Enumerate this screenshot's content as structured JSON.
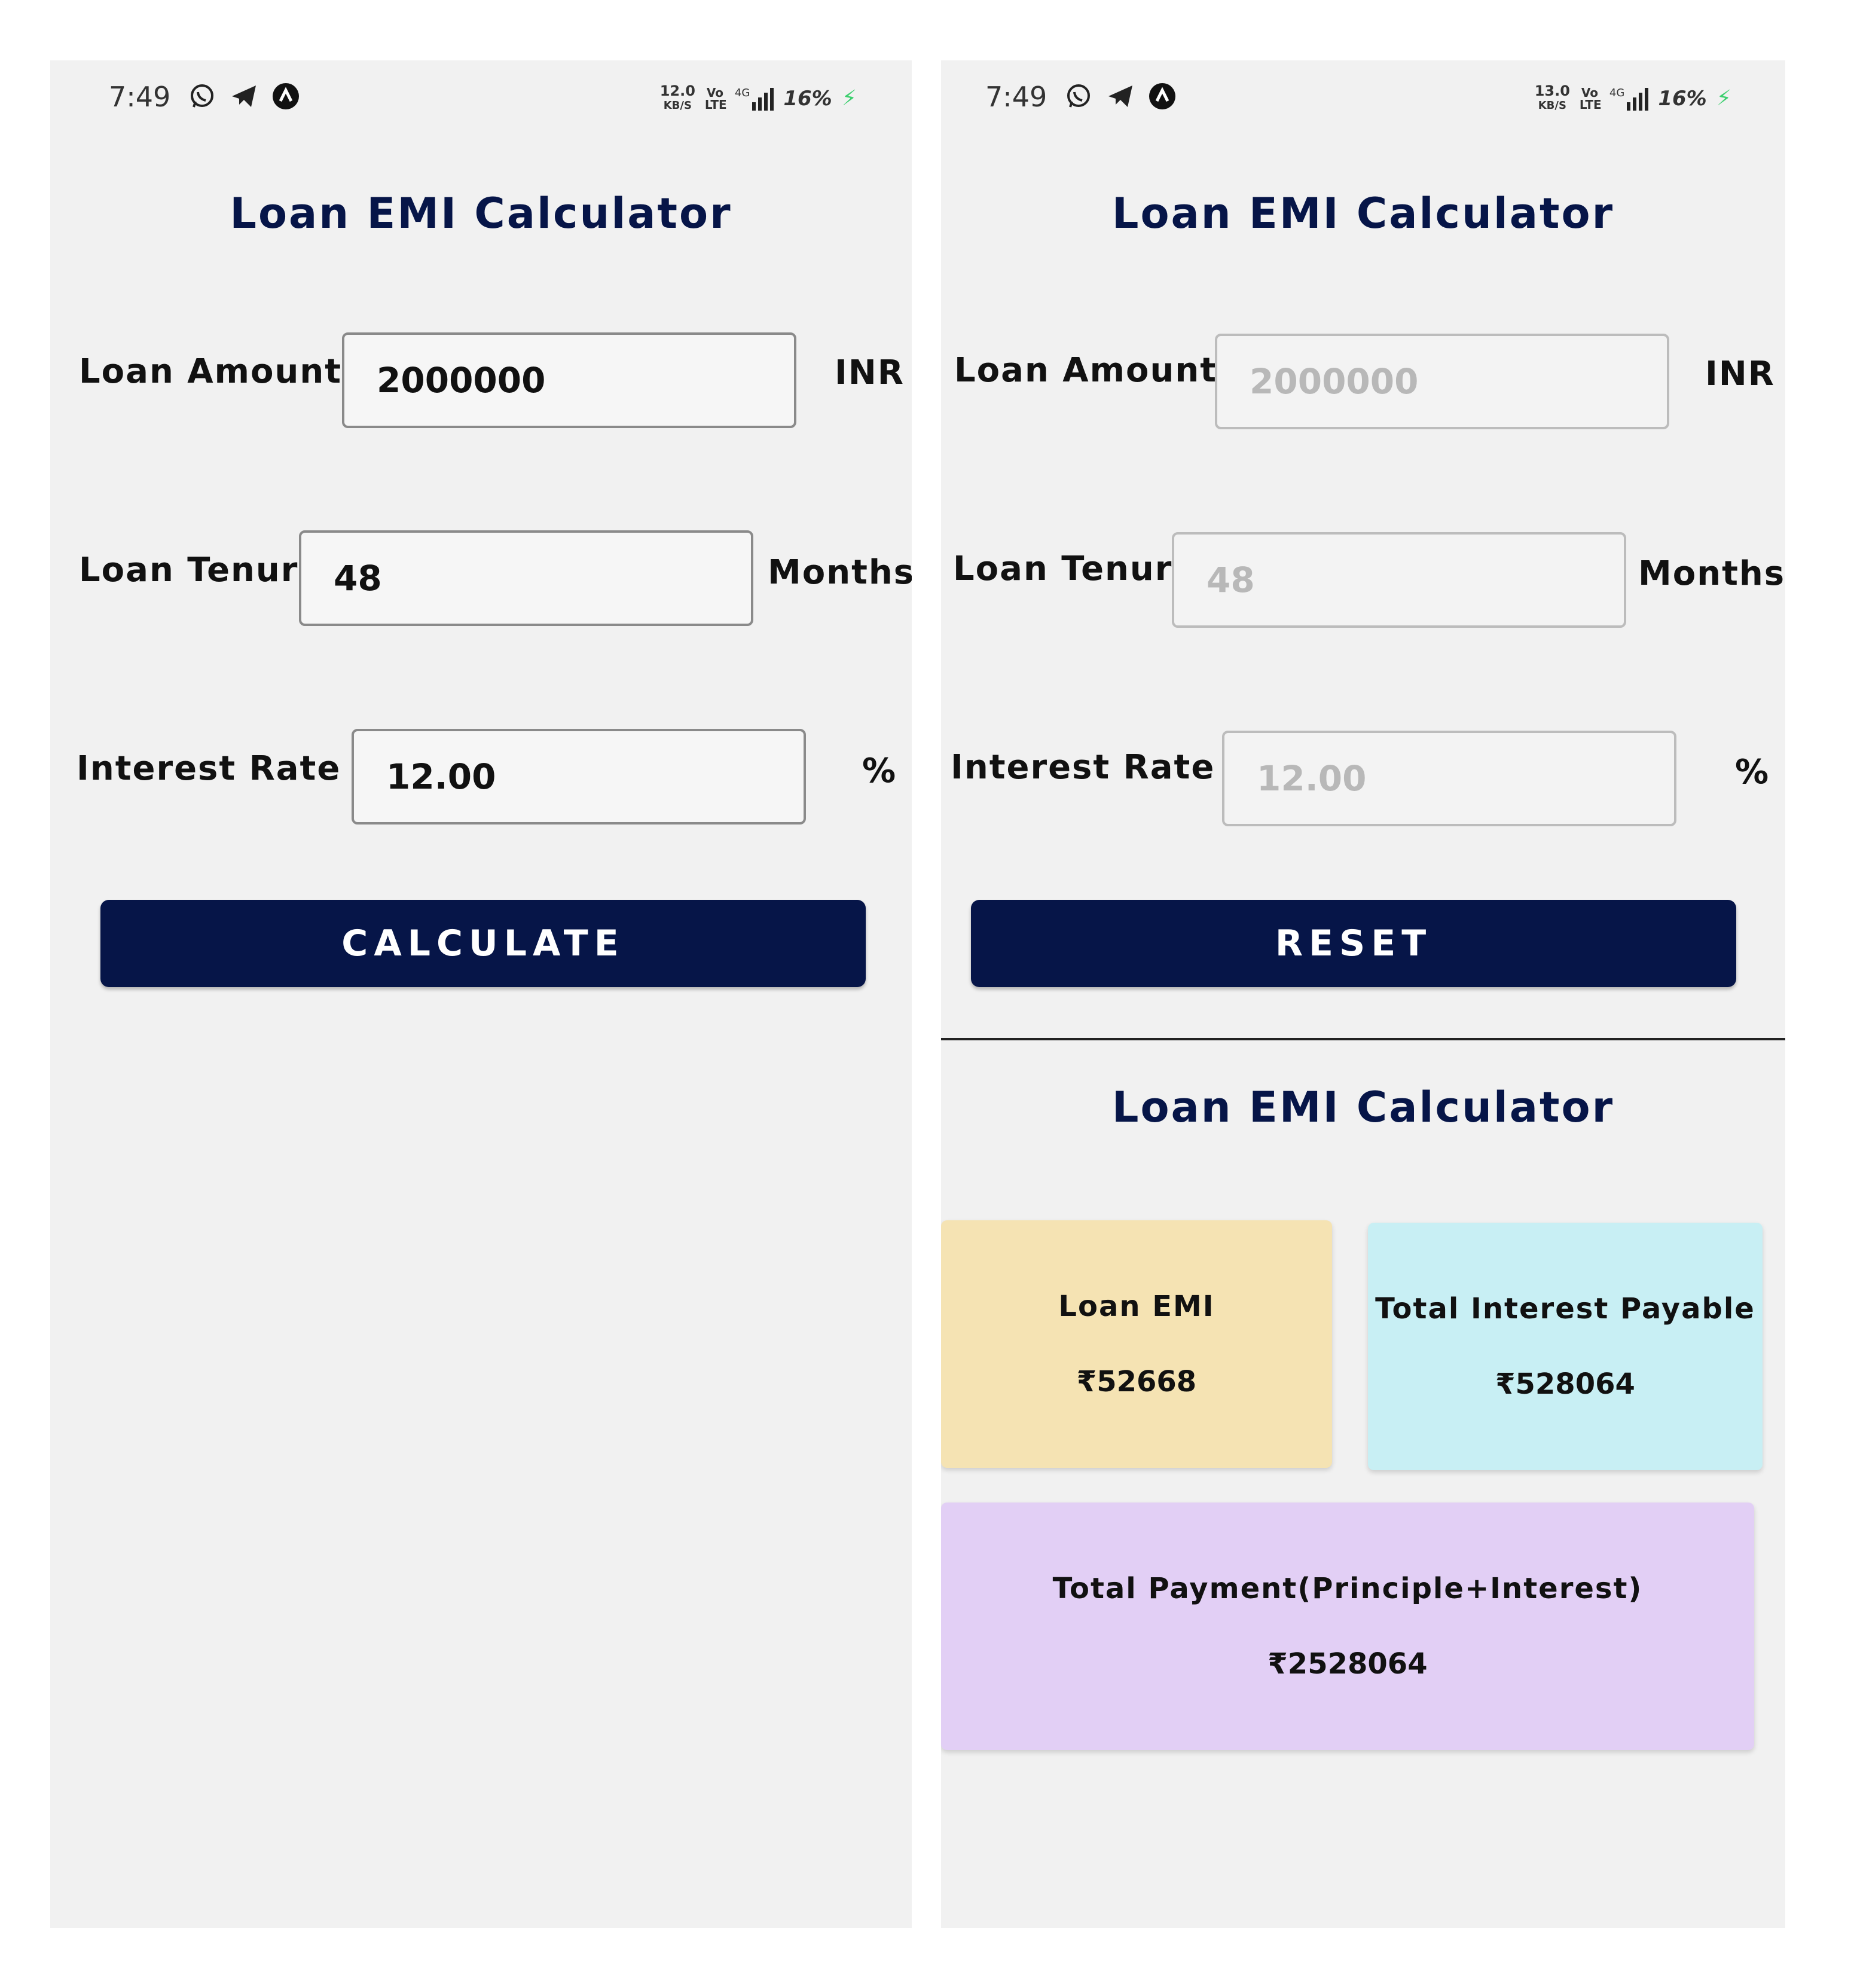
{
  "left_screen": {
    "status": {
      "time": "7:49",
      "net_speed": "12.0",
      "net_unit": "KB/S",
      "volte": "Vo LTE",
      "signal": "4G",
      "battery": "16%"
    },
    "title": "Loan EMI Calculator",
    "loan_amount": {
      "label": "Loan Amount",
      "value": "2000000",
      "unit": "INR"
    },
    "loan_tenure": {
      "label": "Loan Tenure",
      "value": "48",
      "unit": "Months"
    },
    "interest_rate": {
      "label": "Interest Rate",
      "value": "12.00",
      "unit": "%"
    },
    "button": "CALCULATE"
  },
  "right_screen": {
    "status": {
      "time": "7:49",
      "net_speed": "13.0",
      "net_unit": "KB/S",
      "volte": "Vo LTE",
      "signal": "4G",
      "battery": "16%"
    },
    "title": "Loan EMI Calculator",
    "loan_amount": {
      "label": "Loan Amount",
      "placeholder": "2000000",
      "unit": "INR"
    },
    "loan_tenure": {
      "label": "Loan Tenure",
      "placeholder": "48",
      "unit": "Months"
    },
    "interest_rate": {
      "label": "Interest Rate",
      "placeholder": "12.00",
      "unit": "%"
    },
    "button": "RESET",
    "result_title": "Loan EMI Calculator",
    "results": {
      "emi": {
        "label": "Loan EMI",
        "value": "₹52668",
        "color": "#f5e3b3"
      },
      "interest": {
        "label": "Total Interest Payable",
        "value": "₹528064",
        "color": "#c8eff4"
      },
      "total": {
        "label": "Total Payment(Principle+Interest)",
        "value": "₹2528064",
        "color": "#e2cff5"
      }
    }
  },
  "colors": {
    "primary": "#061548",
    "background": "#f1f1f1"
  },
  "icons": [
    "whatsapp-icon",
    "telegram-icon",
    "app-icon",
    "charging-icon"
  ]
}
